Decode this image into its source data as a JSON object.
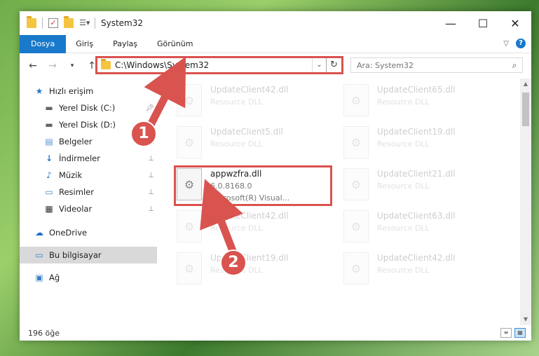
{
  "window": {
    "title": "System32"
  },
  "ribbon": {
    "tabs": [
      "Dosya",
      "Giriş",
      "Paylaş",
      "Görünüm"
    ]
  },
  "address": {
    "path": "C:\\Windows\\System32"
  },
  "search": {
    "placeholder": "Ara: System32"
  },
  "sidebar": {
    "items": [
      {
        "label": "Hızlı erişim"
      },
      {
        "label": "Yerel Disk (C:)"
      },
      {
        "label": "Yerel Disk (D:)"
      },
      {
        "label": "Belgeler"
      },
      {
        "label": "İndirmeler"
      },
      {
        "label": "Müzik"
      },
      {
        "label": "Resimler"
      },
      {
        "label": "Videolar"
      },
      {
        "label": "OneDrive"
      },
      {
        "label": "Bu bilgisayar"
      },
      {
        "label": "Ağ"
      }
    ]
  },
  "files": [
    {
      "name": "UpdateClient42.dll",
      "sub": "Resource DLL"
    },
    {
      "name": "UpdateClient65.dll",
      "sub": "Resource DLL"
    },
    {
      "name": "UpdateClient5.dll",
      "sub": "Resource DLL"
    },
    {
      "name": "UpdateClient19.dll",
      "sub": "Resource DLL"
    },
    {
      "name": "appwzfra.dll",
      "version": "6.0.8168.0",
      "company": "Microsoft(R) Visual..."
    },
    {
      "name": "UpdateClient21.dll",
      "sub": "Resource DLL"
    },
    {
      "name": "UpdateClient42.dll",
      "sub": "Resource DLL"
    },
    {
      "name": "UpdateClient63.dll",
      "sub": "Resource DLL"
    },
    {
      "name": "UpdateClient19.dll",
      "sub": "Resource DLL"
    },
    {
      "name": "UpdateClient42.dll",
      "sub": "Resource DLL"
    }
  ],
  "status": {
    "count": "196 öğe"
  },
  "callouts": [
    "1",
    "2"
  ],
  "colors": {
    "accent": "#1979ca",
    "annotation": "#d9534f"
  }
}
